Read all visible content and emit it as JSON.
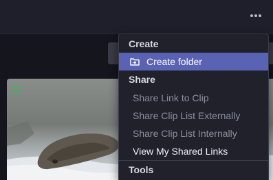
{
  "toolbar": {
    "more_icon": "more-horizontal-icon"
  },
  "thumbnail": {
    "badge_icon": "clip-format-icon",
    "badge_color": "#2fbf4f"
  },
  "menu": {
    "create_header": "Create",
    "create_folder": "Create folder",
    "create_folder_icon": "folder-plus-icon",
    "share_header": "Share",
    "share_link": "Share Link to Clip",
    "share_external": "Share Clip List Externally",
    "share_internal": "Share Clip List Internally",
    "view_links": "View My Shared Links",
    "tools_header": "Tools",
    "highlight_color": "#5a62b4"
  }
}
